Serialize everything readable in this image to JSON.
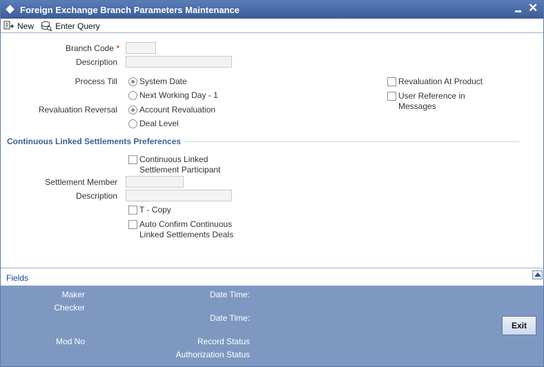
{
  "window": {
    "title": "Foreign Exchange Branch Parameters Maintenance"
  },
  "toolbar": {
    "new_label": "New",
    "enter_query_label": "Enter Query"
  },
  "form": {
    "branch_code_label": "Branch Code",
    "required_marker": "*",
    "branch_code_value": "",
    "description_label": "Description",
    "description_value": "",
    "process_till_label": "Process Till",
    "process_till_options": [
      "System Date",
      "Next Working Day - 1"
    ],
    "process_till_selected": "System Date",
    "revaluation_reversal_label": "Revaluation Reversal",
    "revaluation_reversal_options": [
      "Account Revaluation",
      "Deal Level"
    ],
    "revaluation_reversal_selected": "Account Revaluation",
    "revaluation_at_product_label": "Revaluation At Product",
    "revaluation_at_product_checked": false,
    "user_reference_label_line1": "User Reference in",
    "user_reference_label_line2": "Messages",
    "user_reference_checked": false
  },
  "cls": {
    "section_title": "Continuous Linked Settlements Preferences",
    "participant_label_line1": "Continuous Linked",
    "participant_label_line2": "Settlement Participant",
    "participant_checked": false,
    "settlement_member_label": "Settlement Member",
    "settlement_member_value": "",
    "description_label": "Description",
    "description_value": "",
    "t_copy_label": "T - Copy",
    "t_copy_checked": false,
    "auto_confirm_label_line1": "Auto Confirm Continuous",
    "auto_confirm_label_line2": "Linked Settlements Deals",
    "auto_confirm_checked": false
  },
  "fields_bar": {
    "label": "Fields"
  },
  "footer": {
    "maker_label": "Maker",
    "checker_label": "Checker",
    "date_time_label_1": "Date Time:",
    "date_time_label_2": "Date Time:",
    "mod_no_label": "Mod No",
    "record_status_label": "Record Status",
    "authorization_status_label": "Authorization Status",
    "exit_label": "Exit"
  },
  "colors": {
    "title_bar": "#4a6ca8",
    "section_title": "#3d5f94",
    "footer_bg": "#7f98c2",
    "required": "#d00000"
  }
}
